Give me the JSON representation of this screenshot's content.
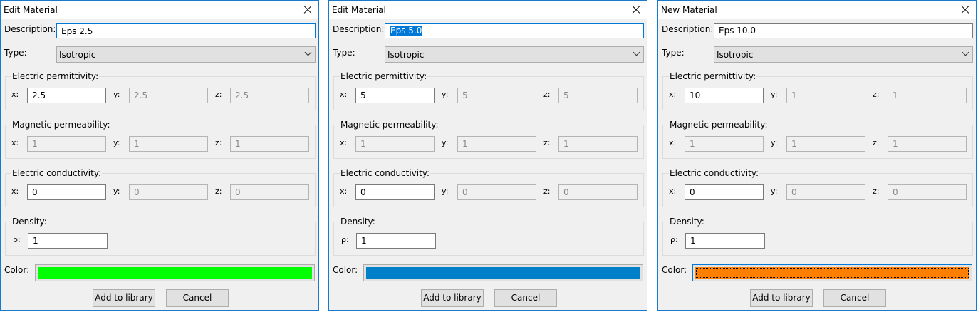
{
  "dialogs": [
    {
      "title": "Edit Material",
      "description": "Eps 2.5",
      "description_state": "caret",
      "type_label": "Type:",
      "type_value": "Isotropic",
      "permittivity": {
        "x": "2.5",
        "y": "2.5",
        "z": "2.5"
      },
      "permeability": {
        "x": "1",
        "y": "1",
        "z": "1"
      },
      "conductivity": {
        "x": "0",
        "y": "0",
        "z": "0"
      },
      "density": "1",
      "color": "#00ff00",
      "color_focused": false
    },
    {
      "title": "Edit Material",
      "description": "Eps 5.0",
      "description_state": "selected",
      "type_label": "Type:",
      "type_value": "Isotropic",
      "permittivity": {
        "x": "5",
        "y": "5",
        "z": "5"
      },
      "permeability": {
        "x": "1",
        "y": "1",
        "z": "1"
      },
      "conductivity": {
        "x": "0",
        "y": "0",
        "z": "0"
      },
      "density": "1",
      "color": "#0080c8",
      "color_focused": false
    },
    {
      "title": "New Material",
      "description": "Eps 10.0",
      "description_state": "plain",
      "type_label": "Type:",
      "type_value": "Isotropic",
      "permittivity": {
        "x": "10",
        "y": "1",
        "z": "1"
      },
      "permeability": {
        "x": "1",
        "y": "1",
        "z": "1"
      },
      "conductivity": {
        "x": "0",
        "y": "0",
        "z": "0"
      },
      "density": "1",
      "color": "#ff8000",
      "color_focused": true
    }
  ],
  "labels": {
    "description": "Description:",
    "permittivity": "Electric permittivity:",
    "permeability": "Magnetic permeability:",
    "conductivity": "Electric conductivity:",
    "density": "Density:",
    "rho": "ρ:",
    "x": "x:",
    "y": "y:",
    "z": "z:",
    "color": "Color:",
    "add_to_library": "Add to library",
    "cancel": "Cancel"
  },
  "theme": {
    "accent": "#0078d7",
    "window_border": "#1979ca"
  }
}
